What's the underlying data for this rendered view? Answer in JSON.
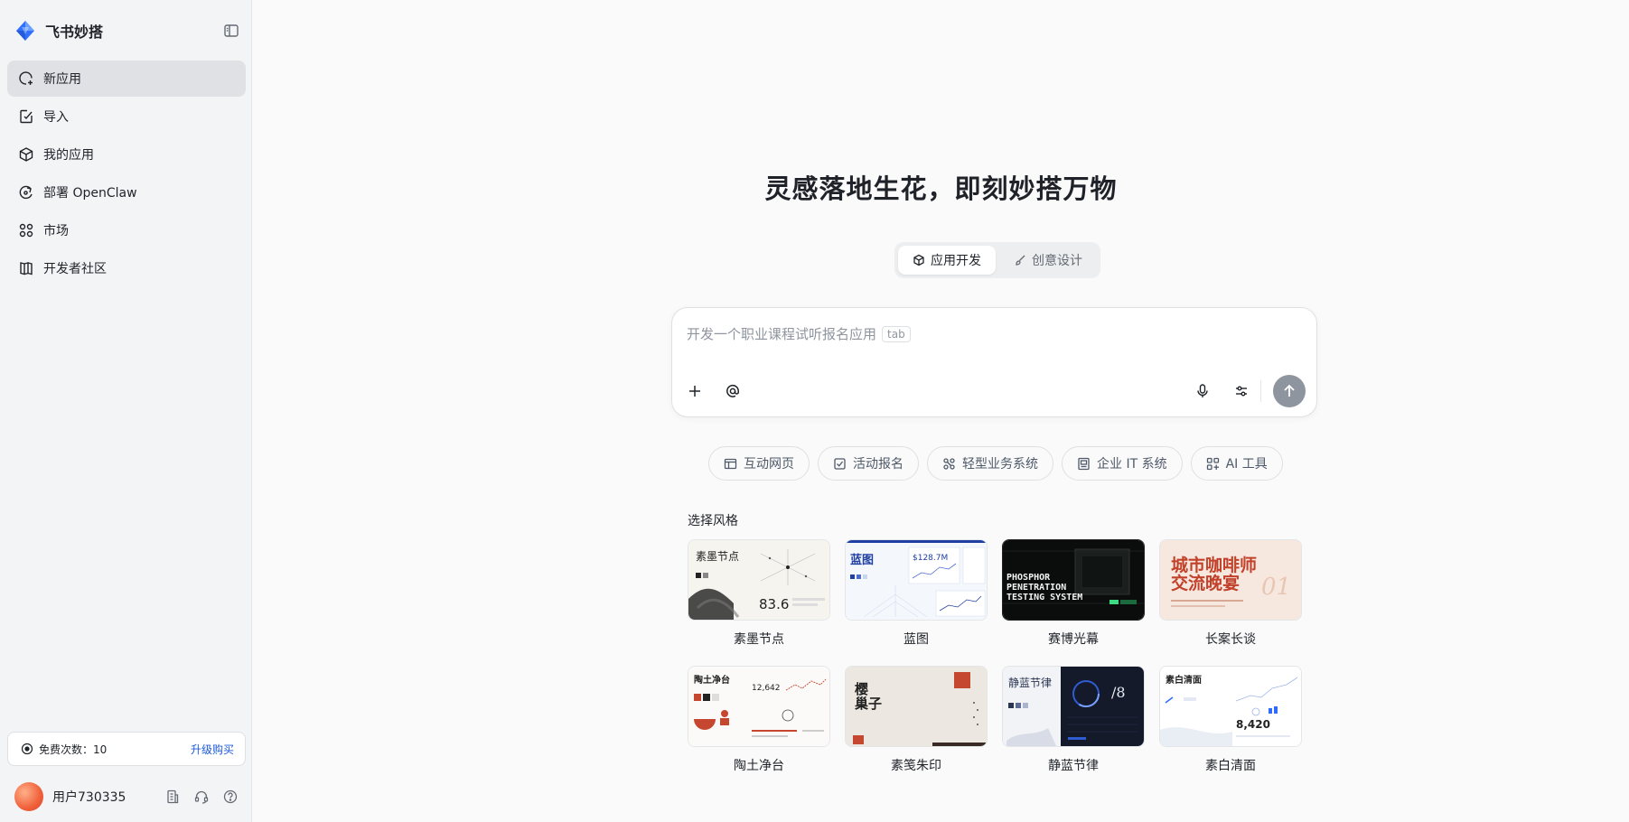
{
  "brand": {
    "name": "飞书妙搭"
  },
  "nav": [
    {
      "label": "新应用",
      "active": true
    },
    {
      "label": "导入"
    },
    {
      "label": "我的应用"
    },
    {
      "label": "部署 OpenClaw"
    },
    {
      "label": "市场"
    },
    {
      "label": "开发者社区"
    }
  ],
  "quota": {
    "label": "免费次数：10",
    "upgrade": "升级购买"
  },
  "user": {
    "name": "用户730335"
  },
  "hero": {
    "title": "灵感落地生花，即刻妙搭万物"
  },
  "modes": [
    {
      "label": "应用开发",
      "active": true
    },
    {
      "label": "创意设计"
    }
  ],
  "composer": {
    "placeholder": "开发一个职业课程试听报名应用",
    "tab_hint": "tab"
  },
  "chips": [
    "互动网页",
    "活动报名",
    "轻型业务系统",
    "企业 IT 系统",
    "AI 工具"
  ],
  "styles": {
    "heading": "选择风格",
    "items": [
      "素墨节点",
      "蓝图",
      "赛博光幕",
      "长案长谈",
      "陶土净台",
      "素笺朱印",
      "静蓝节律",
      "素白清面"
    ],
    "thumb_text": {
      "ink_title": "素墨节点",
      "ink_value": "83.6",
      "blue_title": "蓝图",
      "blue_value": "$128.7M",
      "cyber_line1": "PHOSPHOR",
      "cyber_line2": "PENETRATION",
      "cyber_line3": "TESTING SYSTEM",
      "poster_line1": "城市咖啡师",
      "poster_line2": "交流晚宴",
      "poster_num": "01",
      "clay_title": "陶土净台",
      "clay_value": "12,642",
      "paper_title1": "樱",
      "paper_title2": "巢子",
      "calm_title": "静蓝节律",
      "calm_value": "/8",
      "white_title": "素白清面",
      "white_value": "8,420"
    }
  },
  "colors": {
    "accent": "#1d5ad8",
    "send": "#8f959e",
    "active_nav": "#e0e1e4"
  }
}
